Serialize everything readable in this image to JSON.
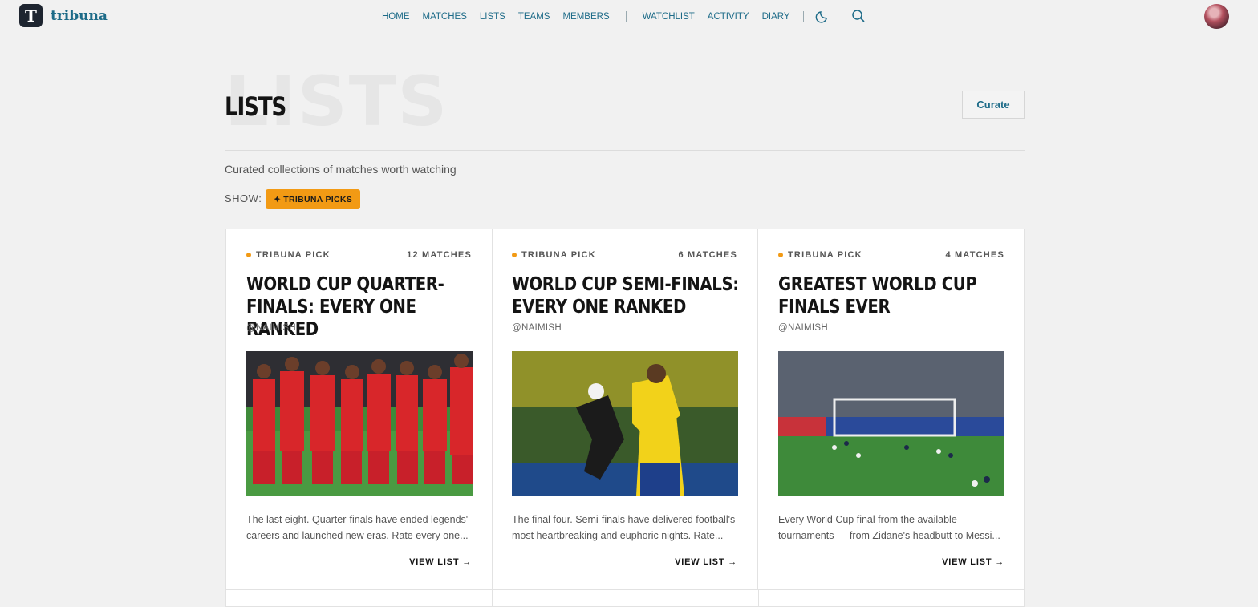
{
  "brand": {
    "logo_letter": "T",
    "name": "tribuna"
  },
  "nav": {
    "items": [
      "HOME",
      "MATCHES",
      "LISTS",
      "TEAMS",
      "MEMBERS"
    ],
    "items2": [
      "WATCHLIST",
      "ACTIVITY",
      "DIARY"
    ],
    "theme_icon": "moon-icon",
    "search_icon": "search-icon"
  },
  "header": {
    "title": "LISTS",
    "watermark": "LISTS",
    "curate_label": "Curate",
    "subtitle": "Curated collections of matches worth watching",
    "show_label": "SHOW:",
    "filter_label": "✦ TRIBUNA PICKS"
  },
  "colors": {
    "accent": "#1d6b88",
    "pick": "#f29a14",
    "background": "#f1f1f1"
  },
  "cards": [
    {
      "tag": "TRIBUNA PICK",
      "count": "12 MATCHES",
      "title": "WORLD CUP QUARTER-FINALS: EVERY ONE RANKED",
      "author": "@NAIMISH",
      "description": "The last eight. Quarter-finals have ended legends' careers and launched new eras. Rate every one...",
      "cta": "VIEW LIST →"
    },
    {
      "tag": "TRIBUNA PICK",
      "count": "6 MATCHES",
      "title": "WORLD CUP SEMI-FINALS: EVERY ONE RANKED",
      "author": "@NAIMISH",
      "description": "The final four. Semi-finals have delivered football's most heartbreaking and euphoric nights. Rate...",
      "cta": "VIEW LIST →"
    },
    {
      "tag": "TRIBUNA PICK",
      "count": "4 MATCHES",
      "title": "GREATEST WORLD CUP FINALS EVER",
      "author": "@NAIMISH",
      "description": "Every World Cup final from the available tournaments — from Zidane's headbutt to Messi...",
      "cta": "VIEW LIST →"
    }
  ]
}
